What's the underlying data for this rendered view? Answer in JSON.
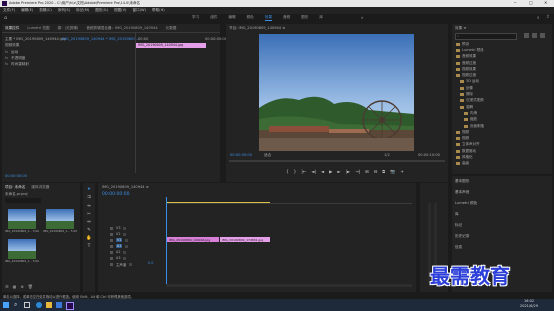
{
  "titlebar": {
    "title": "Adobe Premiere Pro 2020 - C:\\用户\\h\\x\\文档\\Adobe\\Premiere Pro\\14.0\\未命名",
    "minimize": "─",
    "maximize": "□",
    "close": "✕"
  },
  "menubar": [
    "文件(F)",
    "编辑(E)",
    "剪辑(C)",
    "序列(S)",
    "标记(M)",
    "图形(G)",
    "视图(V)",
    "窗口(W)",
    "帮助(H)"
  ],
  "workspaces": {
    "tabs": [
      "学习",
      "组件",
      "编辑",
      "颜色",
      "效果",
      "音频",
      "图形",
      "库"
    ],
    "active_index": 4,
    "more": "»"
  },
  "source_panel": {
    "tabs": [
      "效果控件",
      "Lumetri 范围",
      "源：(无剪辑)",
      "音频剪辑混合器：IMG_20190809_140944",
      "元数据"
    ],
    "master_label": "主要 * IMG_20190809_140944.jpg",
    "clip_label": "IMG_20190809_140944 * IMG_20190809...",
    "timecode_left": "00:00",
    "timecode_right": "00:00:05:00",
    "section_video": "视频效果",
    "rows": [
      "运动",
      "不透明度",
      "时间重映射"
    ],
    "clip_bar": "IMG_20190809_140944.jpg",
    "bottom_timecode": "00:00:00:00"
  },
  "program_panel": {
    "title": "节目: IMG_20190809_140944 ≡",
    "timecode_current": "00:00:00:00",
    "fit": "适合",
    "zoom": "1/2",
    "timecode_total": "00:00:10:00",
    "controls": [
      "{",
      "}",
      "|←",
      "◄|",
      "◄",
      "▶",
      "►",
      "|►",
      "→|",
      "⊞",
      "⊟",
      "⧉",
      "📷",
      "+"
    ]
  },
  "effects_panel": {
    "title": "效果 ≡",
    "search_placeholder": "",
    "tree": [
      {
        "label": "预设",
        "indent": 0
      },
      {
        "label": "Lumetri 预设",
        "indent": 0
      },
      {
        "label": "音频效果",
        "indent": 0
      },
      {
        "label": "音频过渡",
        "indent": 0
      },
      {
        "label": "视频效果",
        "indent": 0
      },
      {
        "label": "视频过渡",
        "indent": 0
      },
      {
        "label": "3D 运动",
        "indent": 1
      },
      {
        "label": "划像",
        "indent": 1
      },
      {
        "label": "擦除",
        "indent": 1
      },
      {
        "label": "沉浸式视频",
        "indent": 1
      },
      {
        "label": "溶解",
        "indent": 1
      },
      {
        "label": "内滑",
        "indent": 2
      },
      {
        "label": "缩放",
        "indent": 2
      },
      {
        "label": "页面剥落",
        "indent": 2
      },
      {
        "label": "视频",
        "indent": 0
      },
      {
        "label": "视频",
        "indent": 0
      },
      {
        "label": "立体声对齐",
        "indent": 0
      },
      {
        "label": "数据驱动",
        "indent": 0
      },
      {
        "label": "风格化",
        "indent": 0
      },
      {
        "label": "高级",
        "indent": 0
      }
    ],
    "lower_items": [
      "基本图形",
      "基本声音",
      "Lumetri 颜色",
      "库",
      "标记",
      "历史记录",
      "信息"
    ]
  },
  "project_panel": {
    "tabs": [
      "项目: 未命名",
      "媒体浏览器"
    ],
    "path": "未命名.prproj",
    "item_count": "",
    "thumbnails": [
      {
        "name": "IMG_20190809_1...",
        "dur": "5:00"
      },
      {
        "name": "IMG_20190809_1...",
        "dur": "5:00"
      },
      {
        "name": "IMG_20190809_1...",
        "dur": "5:00"
      }
    ]
  },
  "timeline": {
    "tab": "IMG_20190809_140944 ≡",
    "timecode": "00:00:00:00",
    "tracks": [
      "V3",
      "V2",
      "V1",
      "A1",
      "A2",
      "A3",
      "主声道"
    ],
    "master_value": "0.0",
    "clip1": "IMG_20190809_140944.jpg",
    "clip2": "IMG_20190809_174801.jpg"
  },
  "statusbar": {
    "text": "单击以选择，或单击空白处并拖动以进行框选。使用 Shift、Alt 和 Ctrl 可获得其他选项。"
  },
  "watermark": "最需教育",
  "taskbar": {
    "time": "16:02",
    "date": "2021/6/29"
  },
  "colors": {
    "accent": "#3a8ee6",
    "clip": "#e59ee8",
    "timeline_clip_label": "#d87fd8",
    "taskbar": "#1e2a3a"
  }
}
